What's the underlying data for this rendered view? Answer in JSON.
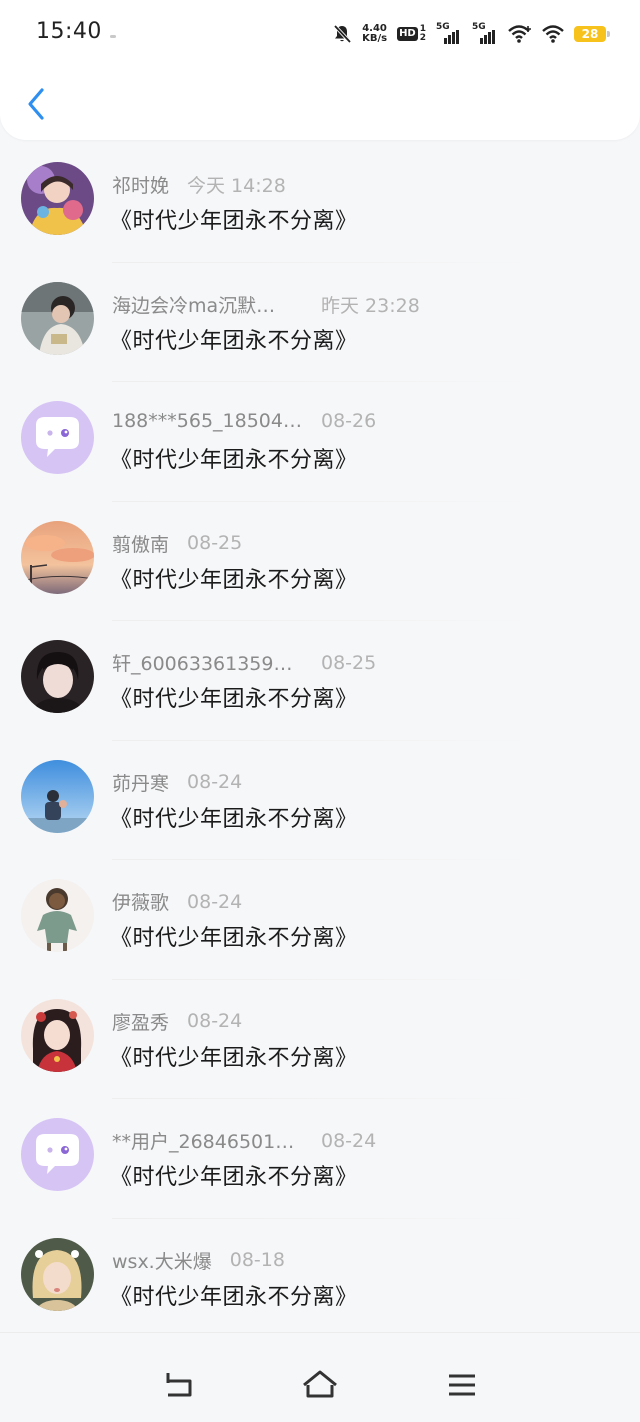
{
  "status_bar": {
    "time": "15:40",
    "net_speed_value": "4.40",
    "net_speed_unit": "KB/s",
    "hd_label": "HD",
    "signal1_label": "5G",
    "signal2_label": "5G",
    "battery": "28",
    "battery_color": "#f7c21b"
  },
  "header": {
    "back_icon": "chevron-left-icon",
    "accent": "#2f8ff0"
  },
  "messages": [
    {
      "name": "祁时娩",
      "date": "今天 14:28",
      "text": "《时代少年团永不分离》"
    },
    {
      "name": "海边会冷ma沉默…",
      "date": "昨天 23:28",
      "text": "《时代少年团永不分离》"
    },
    {
      "name": "188***565_18504…",
      "date": "08-26",
      "text": "《时代少年团永不分离》"
    },
    {
      "name": "翦傲南",
      "date": "08-25",
      "text": "《时代少年团永不分离》"
    },
    {
      "name": "轩_60063361359…",
      "date": "08-25",
      "text": "《时代少年团永不分离》"
    },
    {
      "name": "茆丹寒",
      "date": "08-24",
      "text": "《时代少年团永不分离》"
    },
    {
      "name": "伊薇歌",
      "date": "08-24",
      "text": "《时代少年团永不分离》"
    },
    {
      "name": "廖盈秀",
      "date": "08-24",
      "text": "《时代少年团永不分离》"
    },
    {
      "name": "**用户_26846501…",
      "date": "08-24",
      "text": "《时代少年团永不分离》"
    },
    {
      "name": "wsx.大米爆",
      "date": "08-18",
      "text": "《时代少年团永不分离》"
    }
  ],
  "nav_bar": {
    "back_icon": "back-icon",
    "home_icon": "home-icon",
    "menu_icon": "menu-icon"
  }
}
